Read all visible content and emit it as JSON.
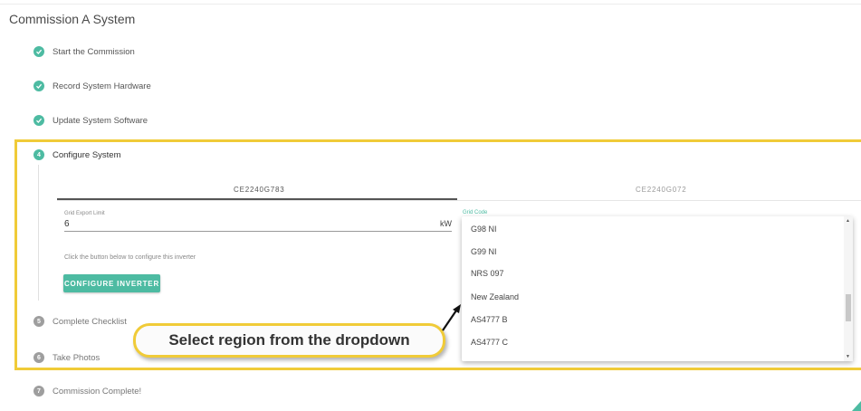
{
  "page": {
    "title": "Commission A System"
  },
  "steps": [
    {
      "number": "1",
      "label": "Start the Commission",
      "status": "done"
    },
    {
      "number": "2",
      "label": "Record System Hardware",
      "status": "done"
    },
    {
      "number": "3",
      "label": "Update System Software",
      "status": "done"
    },
    {
      "number": "4",
      "label": "Configure System",
      "status": "active"
    },
    {
      "number": "5",
      "label": "Complete Checklist",
      "status": "pending"
    },
    {
      "number": "6",
      "label": "Take Photos",
      "status": "pending"
    },
    {
      "number": "7",
      "label": "Commission Complete!",
      "status": "pending"
    }
  ],
  "configure": {
    "tabs": [
      {
        "label": "CE2240G783",
        "selected": true
      },
      {
        "label": "CE2240G072",
        "selected": false
      }
    ],
    "grid_export": {
      "label": "Grid Export Limit",
      "value": "6",
      "unit": "kW"
    },
    "hint": "Click the button below to configure this inverter",
    "button_label": "CONFIGURE INVERTER",
    "grid_code": {
      "label": "Grid Code",
      "options": [
        "G98 NI",
        "G99 NI",
        "NRS 097",
        "New Zealand",
        "AS4777 B",
        "AS4777 C"
      ]
    }
  },
  "callout": {
    "text": "Select region from the dropdown"
  },
  "colors": {
    "accent": "#4dbba2",
    "highlight": "#f0cb38",
    "pending": "#9e9e9e"
  }
}
